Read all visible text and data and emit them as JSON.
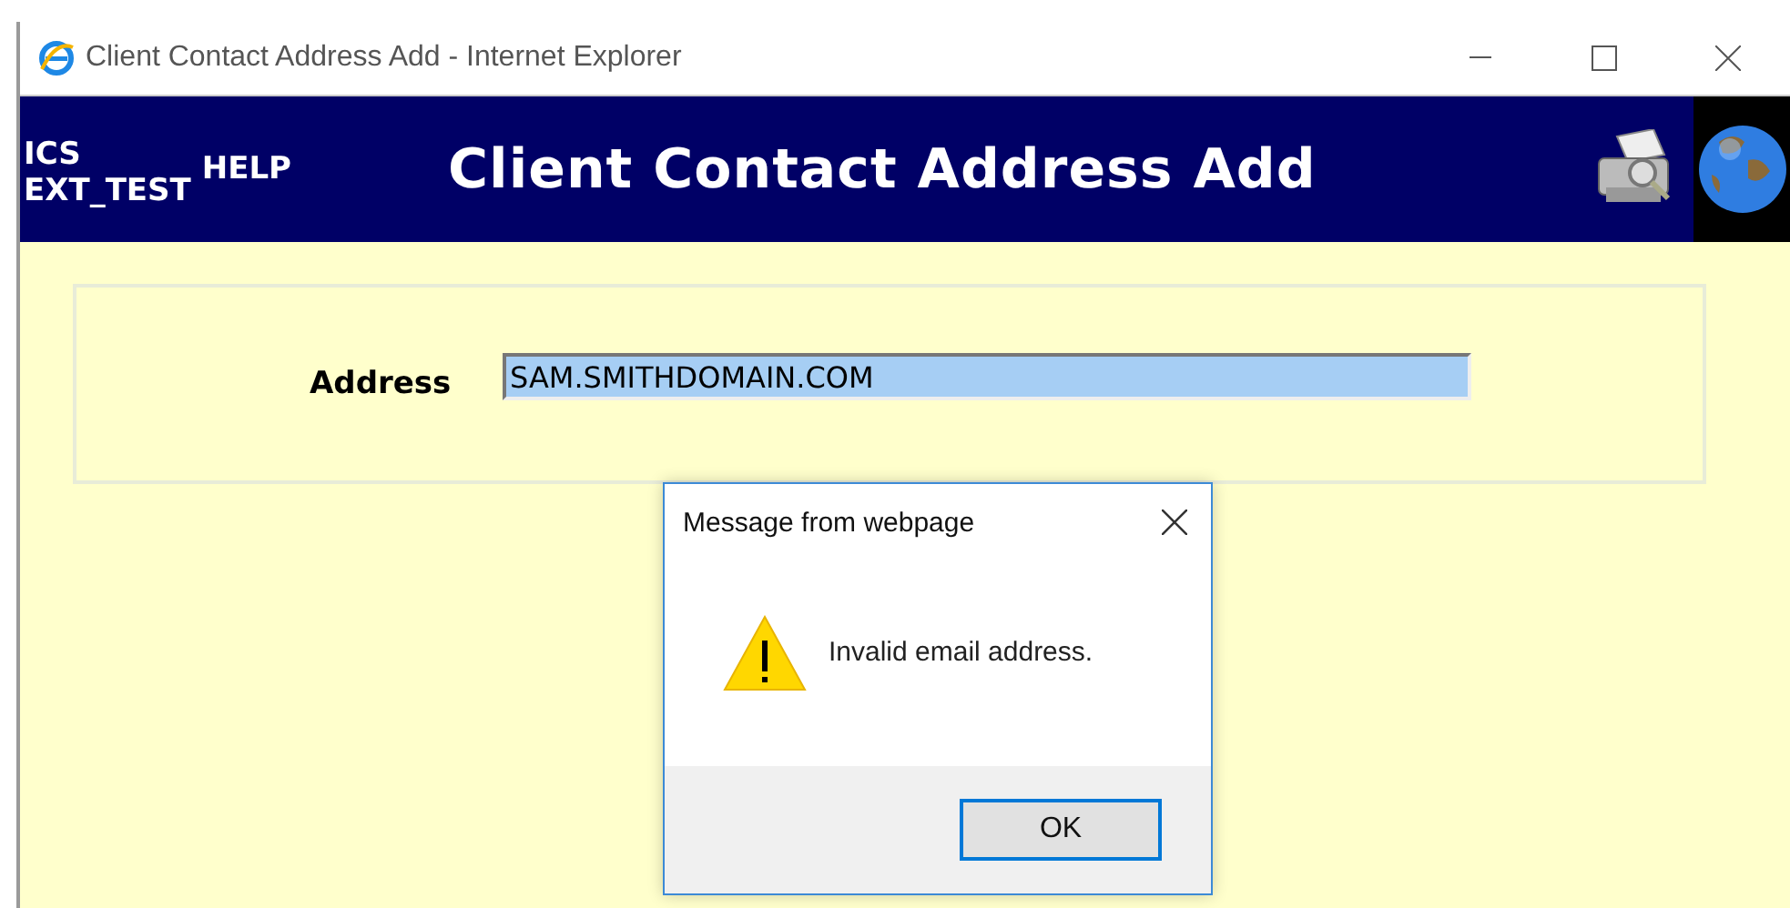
{
  "window": {
    "title": "Client Contact Address Add - Internet Explorer"
  },
  "header": {
    "user_lines": [
      "ICS",
      "EXT_TEST"
    ],
    "help": "HELP",
    "title": "Client Contact Address Add"
  },
  "form": {
    "label": "Address",
    "value": "SAM.SMITHDOMAIN.COM"
  },
  "dialog": {
    "title": "Message from webpage",
    "message": "Invalid email address.",
    "buttons": [
      "OK"
    ]
  }
}
